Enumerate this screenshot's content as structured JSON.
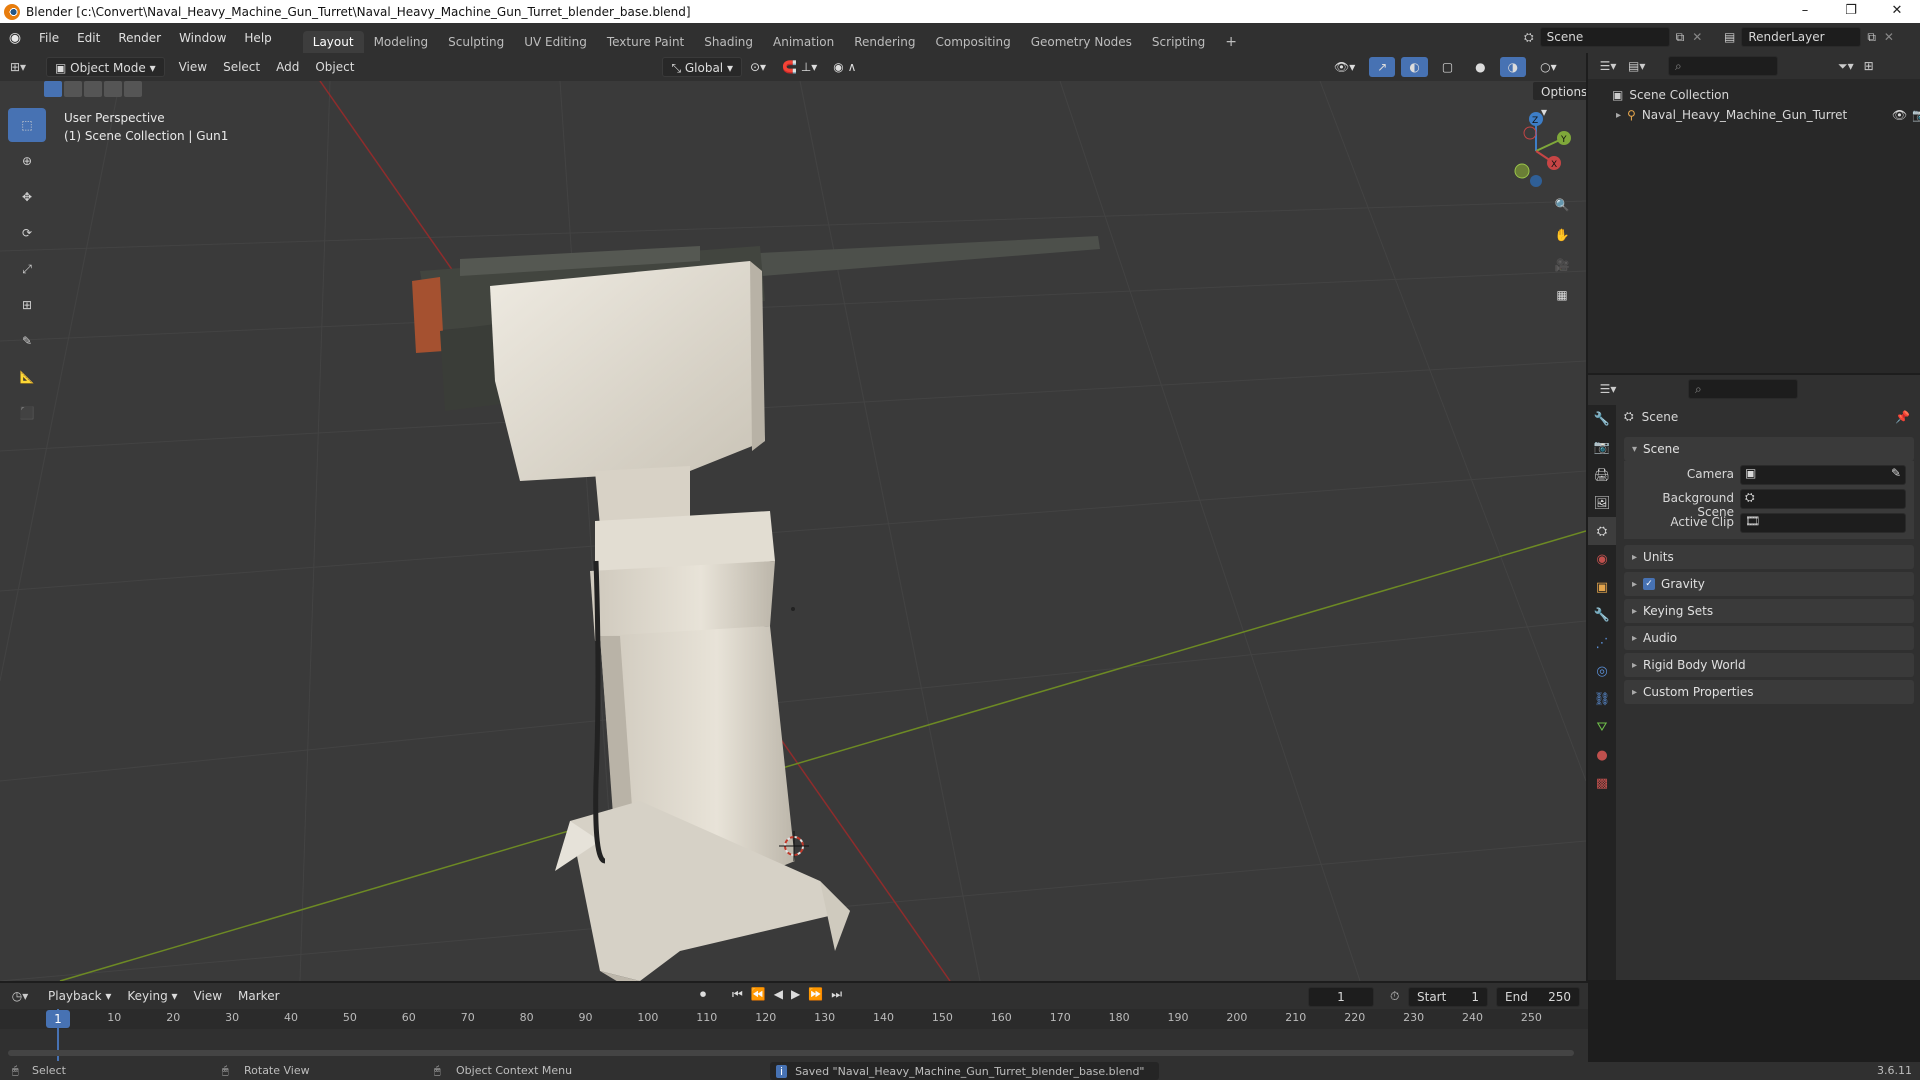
{
  "window": {
    "title": "Blender [c:\\Convert\\Naval_Heavy_Machine_Gun_Turret\\Naval_Heavy_Machine_Gun_Turret_blender_base.blend]",
    "minimize": "–",
    "maximize": "❐",
    "close": "✕"
  },
  "menubar": {
    "menus": [
      "File",
      "Edit",
      "Render",
      "Window",
      "Help"
    ],
    "workspaces": [
      "Layout",
      "Modeling",
      "Sculpting",
      "UV Editing",
      "Texture Paint",
      "Shading",
      "Animation",
      "Rendering",
      "Compositing",
      "Geometry Nodes",
      "Scripting"
    ],
    "active_workspace": "Layout",
    "add_workspace": "+",
    "scene_name": "Scene",
    "view_layer": "RenderLayer"
  },
  "viewport_header": {
    "mode": "Object Mode",
    "menus": [
      "View",
      "Select",
      "Add",
      "Object"
    ],
    "orientation": "Global",
    "options": "Options"
  },
  "viewport": {
    "perspective": "User Perspective",
    "collection_info": "(1) Scene Collection | Gun1",
    "gizmo_axes": {
      "x": "X",
      "y": "Y",
      "z": "Z"
    },
    "colors": {
      "background": "#3a3a3a",
      "x_axis": "#c0392b",
      "y_axis": "#7a9a2a",
      "turret": "#ded8cc",
      "gun_metal": "#4a4d48"
    }
  },
  "outliner": {
    "root": "Scene Collection",
    "items": [
      {
        "name": "Naval_Heavy_Machine_Gun_Turret"
      }
    ]
  },
  "properties": {
    "context": "Scene",
    "panel_scene": "Scene",
    "fields": [
      {
        "label": "Camera",
        "value": ""
      },
      {
        "label": "Background Scene",
        "value": ""
      },
      {
        "label": "Active Clip",
        "value": ""
      }
    ],
    "sub_panels": [
      "Units",
      "Gravity",
      "Keying Sets",
      "Audio",
      "Rigid Body World",
      "Custom Properties"
    ],
    "gravity_checked": true
  },
  "timeline": {
    "menus": [
      "Playback",
      "Keying",
      "View",
      "Marker"
    ],
    "current_frame": "1",
    "start_label": "Start",
    "start": "1",
    "end_label": "End",
    "end": "250",
    "ruler": [
      "1",
      "10",
      "20",
      "30",
      "40",
      "50",
      "60",
      "70",
      "80",
      "90",
      "100",
      "110",
      "120",
      "130",
      "140",
      "150",
      "160",
      "170",
      "180",
      "190",
      "200",
      "210",
      "220",
      "230",
      "240",
      "250"
    ]
  },
  "statusbar": {
    "select": "Select",
    "rotate": "Rotate View",
    "context_menu": "Object Context Menu",
    "message": "Saved \"Naval_Heavy_Machine_Gun_Turret_blender_base.blend\"",
    "version": "3.6.11"
  }
}
